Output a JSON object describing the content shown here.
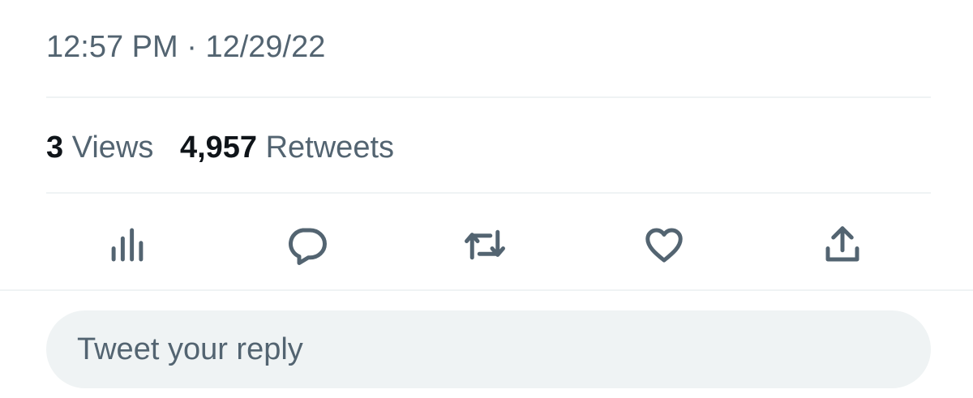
{
  "tweet": {
    "time": "12:57 PM",
    "separator": "·",
    "date": "12/29/22"
  },
  "stats": {
    "views_count": "3",
    "views_label": "Views",
    "retweets_count": "4,957",
    "retweets_label": "Retweets"
  },
  "actions": [
    {
      "icon": "analytics-icon"
    },
    {
      "icon": "reply-icon"
    },
    {
      "icon": "retweet-icon"
    },
    {
      "icon": "like-icon"
    },
    {
      "icon": "share-icon"
    }
  ],
  "reply": {
    "placeholder": "Tweet your reply"
  },
  "colors": {
    "secondary_text": "#536471",
    "primary_text": "#0f1419",
    "divider": "#eff3f4",
    "reply_bg": "#eff3f4"
  }
}
